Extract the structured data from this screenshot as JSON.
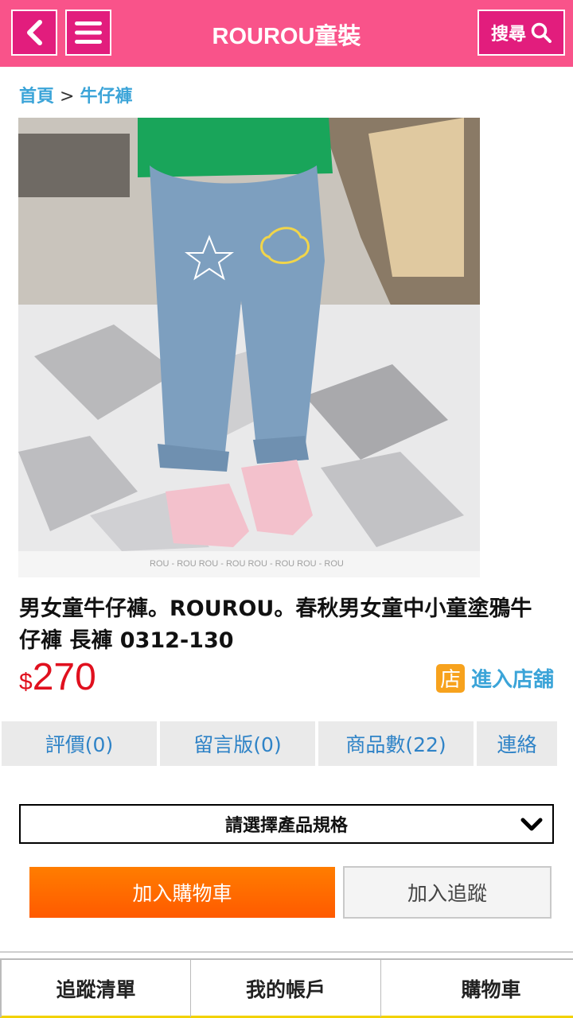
{
  "header": {
    "title": "ROUROU童裝",
    "search_label": "搜尋",
    "back_icon": "chevron-left-icon",
    "menu_icon": "hamburger-menu-icon",
    "search_icon": "magnifier-icon"
  },
  "breadcrumb": {
    "home": "首頁",
    "separator": ">",
    "category": "牛仔褲"
  },
  "product": {
    "photo_watermark": "ROU - ROU    ROU - ROU    ROU - ROU    ROU - ROU",
    "title": "男女童牛仔褲。ROUROU。春秋男女童中小童塗鴉牛仔褲 長褲 0312-130",
    "currency": "$",
    "price": "270",
    "store_badge": "店",
    "store_link": "進入店舖"
  },
  "tabs": [
    {
      "label": "評價(0)"
    },
    {
      "label": "留言版(0)"
    },
    {
      "label": "商品數(22)"
    },
    {
      "label": "連絡"
    }
  ],
  "spec_select": {
    "selected": "請選擇產品規格"
  },
  "actions": {
    "add_to_cart": "加入購物車",
    "add_to_track": "加入追蹤"
  },
  "bottom_nav": [
    {
      "label": "追蹤清單"
    },
    {
      "label": "我的帳戶"
    },
    {
      "label": "購物車"
    }
  ],
  "colors": {
    "header_bg": "#f9538a",
    "header_button": "#e21d7d",
    "link_blue": "#3ba4d8",
    "price_red": "#e0101e",
    "cart_orange": "#ff6a00",
    "store_badge": "#f7a21d"
  }
}
